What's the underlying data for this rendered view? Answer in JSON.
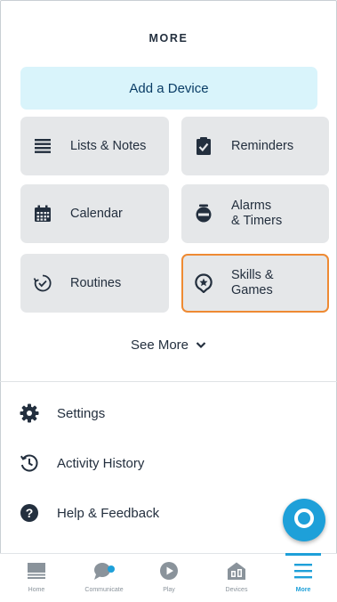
{
  "header": {
    "title": "MORE"
  },
  "add_device": {
    "label": "Add a Device"
  },
  "tiles": [
    {
      "label": "Lists & Notes",
      "icon": "list-icon"
    },
    {
      "label": "Reminders",
      "icon": "clipboard-check-icon"
    },
    {
      "label": "Calendar",
      "icon": "calendar-icon"
    },
    {
      "label": "Alarms\n& Timers",
      "icon": "alarm-clock-icon"
    },
    {
      "label": "Routines",
      "icon": "routines-icon"
    },
    {
      "label": "Skills &\nGames",
      "icon": "skills-icon",
      "selected": true
    }
  ],
  "see_more": {
    "label": "See More"
  },
  "menu": [
    {
      "label": "Settings",
      "icon": "gear-icon"
    },
    {
      "label": "Activity History",
      "icon": "history-icon"
    },
    {
      "label": "Help & Feedback",
      "icon": "help-icon"
    }
  ],
  "tabbar": [
    {
      "label": "Home",
      "icon": "home-icon"
    },
    {
      "label": "Communicate",
      "icon": "chat-icon"
    },
    {
      "label": "Play",
      "icon": "play-icon"
    },
    {
      "label": "Devices",
      "icon": "devices-icon"
    },
    {
      "label": "More",
      "icon": "menu-icon",
      "active": true
    }
  ],
  "colors": {
    "accent": "#1ea0d9",
    "selected_border": "#ee8a33",
    "tile_bg": "#e5e7e9",
    "add_device_bg": "#d9f4fb"
  }
}
